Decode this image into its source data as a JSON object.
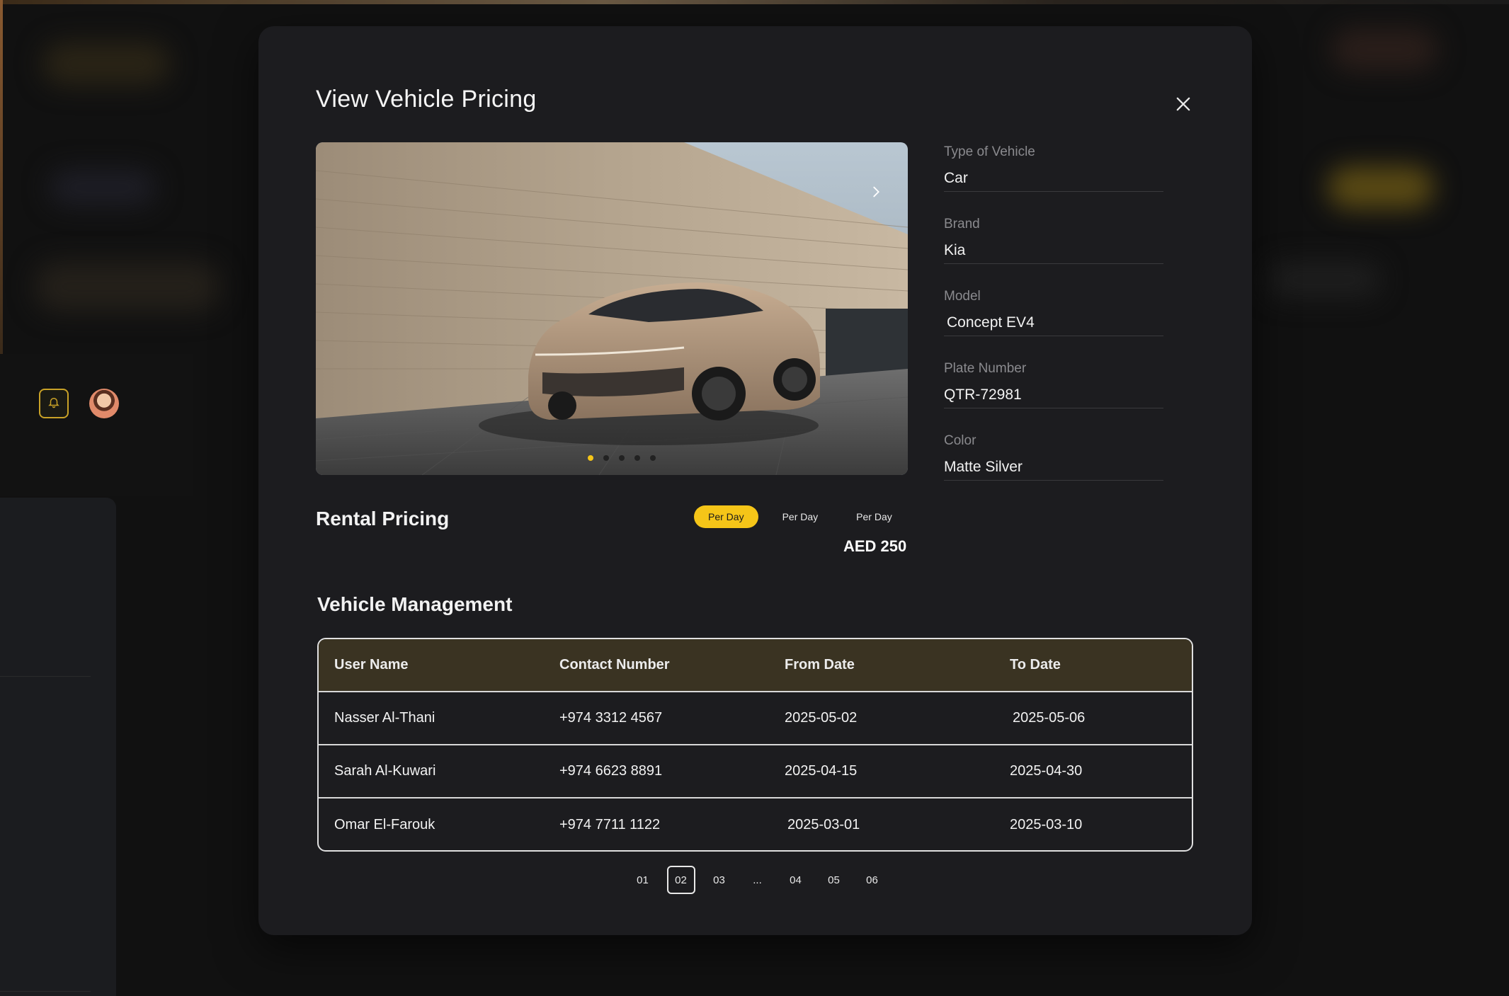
{
  "modal": {
    "title": "View Vehicle Pricing"
  },
  "vehicle": {
    "type_label": "Type of Vehicle",
    "type_value": "Car",
    "brand_label": "Brand",
    "brand_value": "Kia",
    "model_label": "Model",
    "model_value": "Concept EV4",
    "plate_label": "Plate Number",
    "plate_value": "QTR-72981",
    "color_label": "Color",
    "color_value": "Matte Silver"
  },
  "carousel": {
    "slide_count": 5,
    "active_slide": 1
  },
  "pricing": {
    "title": "Rental Pricing",
    "tabs": [
      "Per Day",
      "Per Day",
      "Per Day"
    ],
    "active_tab": 0,
    "price": "AED 250"
  },
  "management": {
    "title": "Vehicle Management",
    "columns": [
      "User Name",
      "Contact Number",
      "From Date",
      "To Date"
    ],
    "rows": [
      [
        "Nasser Al-Thani",
        "+974 3312 4567",
        "2025-05-02",
        "2025-05-06"
      ],
      [
        "Sarah Al-Kuwari",
        "+974 6623 8891",
        "2025-04-15",
        "2025-04-30"
      ],
      [
        "Omar El-Farouk",
        "+974 7711 1122",
        "2025-03-01",
        "2025-03-10"
      ]
    ]
  },
  "pagination": {
    "pages": [
      "01",
      "02",
      "03",
      "...",
      "04",
      "05",
      "06"
    ],
    "active": "02"
  },
  "colors": {
    "accent": "#f5c518",
    "modal_bg": "#1c1c1f",
    "table_header_bg": "#3a3322"
  },
  "icons": {
    "close": "close-icon",
    "next": "chevron-right-icon",
    "bell": "bell-icon"
  }
}
